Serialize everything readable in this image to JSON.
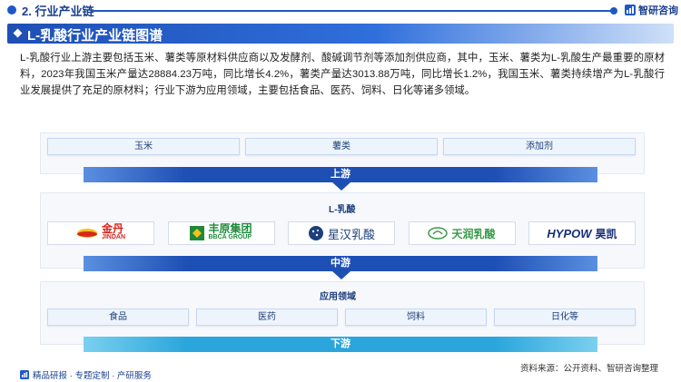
{
  "header": {
    "section_title": "2. 行业产业链",
    "brand": "智研咨询",
    "brand_icon": "bar-chart-icon"
  },
  "title_bar": {
    "title": "L-乳酸行业产业链图谱"
  },
  "intro": "L-乳酸行业上游主要包括玉米、薯类等原材料供应商以及发酵剂、酸碱调节剂等添加剂供应商，其中，玉米、薯类为L-乳酸生产最重要的原材料，2023年我国玉米产量达28884.23万吨，同比增长4.2%，薯类产量达3013.88万吨，同比增长1.2%，我国玉米、薯类持续增产为L-乳酸行业发展提供了充足的原材料；行业下游为应用领域，主要包括食品、医药、饲料、日化等诸多领域。",
  "diagram": {
    "upstream_items": [
      "玉米",
      "薯类",
      "添加剂"
    ],
    "upstream_label": "上游",
    "midstream_title": "L-乳酸",
    "companies": [
      {
        "name": "金丹",
        "sub": "JINDAN",
        "logo_color": "#d8261c"
      },
      {
        "name": "丰原集团",
        "sub": "BBCA GROUP",
        "logo_color": "#1d8a3a"
      },
      {
        "name": "星汉乳酸",
        "sub": "",
        "logo_color": "#1d3f7a"
      },
      {
        "name": "天润乳酸",
        "sub": "",
        "logo_color": "#3a9a4a"
      },
      {
        "name": "HYPOW",
        "sub": "昊凯",
        "logo_color": "#1a2f7a"
      }
    ],
    "midstream_label": "中游",
    "downstream_title": "应用领域",
    "downstream_items": [
      "食品",
      "医药",
      "饲料",
      "日化等"
    ],
    "downstream_label": "下游"
  },
  "footer": {
    "left": "精品研报 · 专题定制 · 产研服务",
    "left_icon": "chart-icon",
    "source": "资料来源：公开资料、智研咨询整理"
  },
  "colors": {
    "primary": "#1e4fb5",
    "accent": "#2aa6dc",
    "box_bg": "#eef4fc"
  }
}
